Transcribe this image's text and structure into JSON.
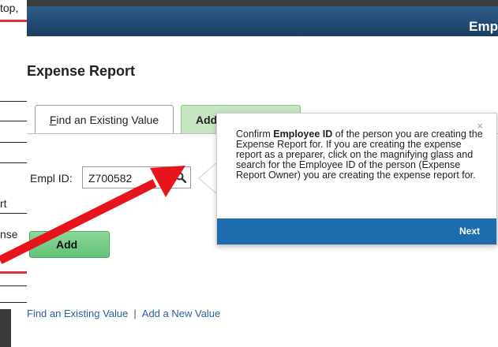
{
  "background_fragments": {
    "frag1": "top,",
    "frag2": "rt",
    "frag3": "nse"
  },
  "header": {
    "title": "Emp"
  },
  "page": {
    "title": "Expense Report"
  },
  "tabs": {
    "find_prefix": "F",
    "find_rest": "ind an Existing Value",
    "add_partial": "Add"
  },
  "form": {
    "empl_label": "Empl ID:",
    "empl_value": "Z700582",
    "add_button": "Add"
  },
  "footer_links": {
    "find": "Find an Existing Value",
    "separator": "|",
    "add": "Add a New Value"
  },
  "popover": {
    "close": "×",
    "text_before": "Confirm ",
    "text_bold": "Employee ID",
    "text_after": " of the person you are creating the Expense Report for. If you are creating the expense report as a preparer, click on the magnifying glass and search for the Employee ID of the person (Expense Report Owner) you are creating the expense report for.",
    "next_label": "Next"
  },
  "colors": {
    "header_blue": "#1a3e63",
    "add_button_green": "#62c277",
    "popover_footer_blue": "#1e6cae",
    "annotation_arrow_red": "#e8141c",
    "link_blue": "#2b5fa5"
  }
}
